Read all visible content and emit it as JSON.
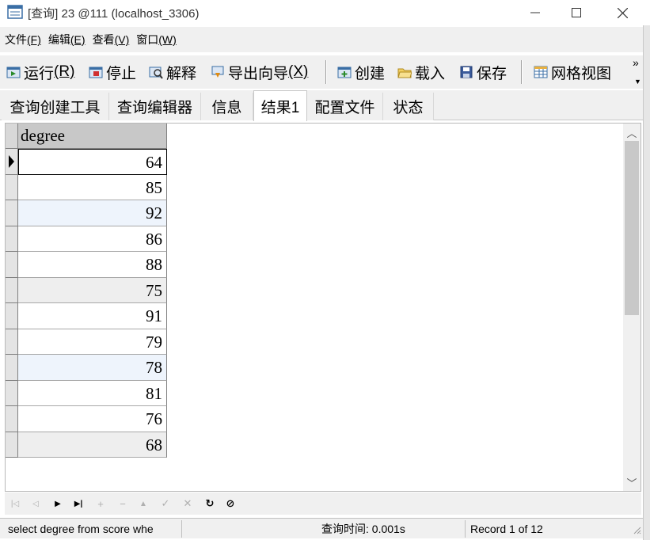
{
  "window": {
    "title": "[查询] 23 @111 (localhost_3306)",
    "minimize_icon": "minimize-icon",
    "maximize_icon": "maximize-icon",
    "close_icon": "close-icon"
  },
  "menu": [
    {
      "label": "文件",
      "accel": "(F)"
    },
    {
      "label": "编辑",
      "accel": "(E)"
    },
    {
      "label": "查看",
      "accel": "(V)"
    },
    {
      "label": "窗口",
      "accel": "(W)"
    }
  ],
  "toolbar": {
    "run": {
      "label": "运行",
      "accel": "(R)"
    },
    "stop": {
      "label": "停止"
    },
    "explain": {
      "label": "解释"
    },
    "export_wizard": {
      "label": "导出向导",
      "accel": "(X)"
    },
    "create": {
      "label": "创建"
    },
    "load": {
      "label": "载入"
    },
    "save": {
      "label": "保存"
    },
    "grid_view": {
      "label": "网格视图"
    },
    "more": "»"
  },
  "tabs": [
    {
      "label": "查询创建工具",
      "active": false
    },
    {
      "label": "查询编辑器",
      "active": false
    },
    {
      "label": "信息",
      "active": false
    },
    {
      "label": "结果1",
      "active": true
    },
    {
      "label": "配置文件",
      "active": false
    },
    {
      "label": "状态",
      "active": false
    }
  ],
  "grid": {
    "column": "degree",
    "rows": [
      "64",
      "85",
      "92",
      "86",
      "88",
      "75",
      "91",
      "79",
      "78",
      "81",
      "76",
      "68"
    ],
    "current_row": 0
  },
  "navigation": {
    "buttons": [
      "|◁",
      "◁",
      "▶",
      "▶|",
      "+",
      "−",
      "▲",
      "✓",
      "✕",
      "↻",
      "⊘"
    ]
  },
  "status": {
    "sql": "select degree from score whe",
    "query_time": "查询时间: 0.001s",
    "record": "Record 1 of 12"
  },
  "colors": {
    "chrome": "#f0f0f0",
    "header": "#c8c8c8",
    "alt_row_blue": "#eef4fc",
    "alt_row_gray": "#eeeeee"
  }
}
